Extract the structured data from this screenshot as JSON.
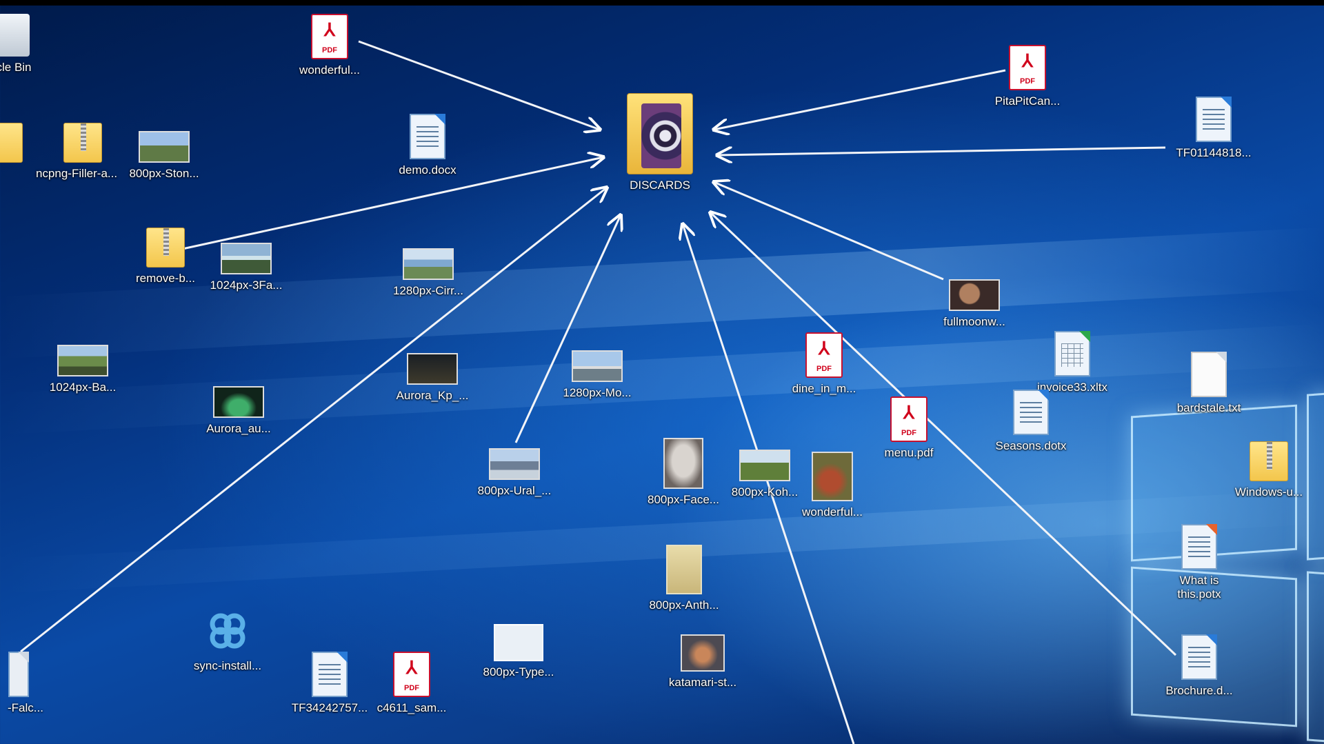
{
  "desktop": {
    "target_folder": {
      "label": "DISCARDS",
      "icon": "folder-icon"
    },
    "icons": [
      {
        "id": "recycle",
        "label": "cle Bin",
        "icon": "recycle-bin-icon"
      },
      {
        "id": "wonderful-pdf",
        "label": "wonderful...",
        "icon": "pdf-icon"
      },
      {
        "id": "pitapit",
        "label": "PitaPitCan...",
        "icon": "pdf-icon"
      },
      {
        "id": "tf01144818",
        "label": "TF01144818...",
        "icon": "document-icon"
      },
      {
        "id": "nc",
        "label": "nc",
        "icon": "folder-icon"
      },
      {
        "id": "png-filler",
        "label": "png-Filler-a...",
        "icon": "zip-folder-icon"
      },
      {
        "id": "stone",
        "label": "800px-Ston...",
        "icon": "image-icon"
      },
      {
        "id": "demo",
        "label": "demo.docx",
        "icon": "document-icon"
      },
      {
        "id": "remove-b",
        "label": "remove-b...",
        "icon": "zip-folder-icon"
      },
      {
        "id": "3fa",
        "label": "1024px-3Fa...",
        "icon": "image-icon"
      },
      {
        "id": "cirr",
        "label": "1280px-Cirr...",
        "icon": "image-icon"
      },
      {
        "id": "fullmoon",
        "label": "fullmoonw...",
        "icon": "image-icon"
      },
      {
        "id": "ba",
        "label": "1024px-Ba...",
        "icon": "image-icon"
      },
      {
        "id": "aurora-kp",
        "label": "Aurora_Kp_...",
        "icon": "image-icon"
      },
      {
        "id": "mo",
        "label": "1280px-Mo...",
        "icon": "image-icon"
      },
      {
        "id": "dine",
        "label": "dine_in_m...",
        "icon": "pdf-icon"
      },
      {
        "id": "invoice",
        "label": "invoice33.xltx",
        "icon": "spreadsheet-icon"
      },
      {
        "id": "bards",
        "label": "bardstale.txt",
        "icon": "text-file-icon"
      },
      {
        "id": "aurora-au",
        "label": "Aurora_au...",
        "icon": "image-icon"
      },
      {
        "id": "menu",
        "label": "menu.pdf",
        "icon": "pdf-icon"
      },
      {
        "id": "seasons",
        "label": "Seasons.dotx",
        "icon": "document-icon"
      },
      {
        "id": "ural",
        "label": "800px-Ural_...",
        "icon": "image-icon"
      },
      {
        "id": "face",
        "label": "800px-Face...",
        "icon": "image-icon"
      },
      {
        "id": "koh",
        "label": "800px-Koh...",
        "icon": "image-icon"
      },
      {
        "id": "wonderful-img",
        "label": "wonderful...",
        "icon": "image-icon"
      },
      {
        "id": "windows-u",
        "label": "Windows-u...",
        "icon": "zip-folder-icon"
      },
      {
        "id": "whatis",
        "label": "What is this.potx",
        "icon": "presentation-icon"
      },
      {
        "id": "anth",
        "label": "800px-Anth...",
        "icon": "image-icon"
      },
      {
        "id": "sync",
        "label": "sync-install...",
        "icon": "sync-icon"
      },
      {
        "id": "type",
        "label": "800px-Type...",
        "icon": "image-icon"
      },
      {
        "id": "katamari",
        "label": "katamari-st...",
        "icon": "image-icon"
      },
      {
        "id": "tf3424",
        "label": "TF34242757...",
        "icon": "document-icon"
      },
      {
        "id": "c4611",
        "label": "c4611_sam...",
        "icon": "pdf-icon"
      },
      {
        "id": "brochure",
        "label": "Brochure.d...",
        "icon": "document-icon"
      },
      {
        "id": "falc",
        "label": "-Falc...",
        "icon": "file-icon"
      }
    ]
  }
}
